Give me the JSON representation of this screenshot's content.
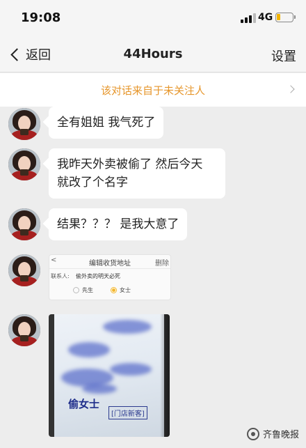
{
  "status_bar": {
    "time": "19:08",
    "network": "4G",
    "battery_level": 0.25,
    "icons": [
      "signal-icon",
      "battery-icon"
    ]
  },
  "nav": {
    "back_label": "返回",
    "title": "44Hours",
    "settings_label": "设置"
  },
  "notice": {
    "text": "该对话来自于未关注人"
  },
  "messages": [
    {
      "type": "text",
      "lines": [
        "全有姐姐 我气死了"
      ]
    },
    {
      "type": "text",
      "lines": [
        "我昨天外卖被偷了 然后今天",
        "就改了个名字"
      ]
    },
    {
      "type": "text",
      "lines": [
        "结果？？？ 是我大意了"
      ]
    },
    {
      "type": "image",
      "image": {
        "kind": "address-form-screenshot",
        "back": "<",
        "title": "编辑收货地址",
        "delete": "删除",
        "contact_label": "联系人:",
        "contact_value": "偷外卖的明天必死",
        "options": [
          "先生",
          "女士"
        ],
        "selected_option": "女士"
      }
    },
    {
      "type": "image",
      "image": {
        "kind": "photo-of-delivery-bag",
        "name_text": "偷女士",
        "stamp_text": "[门店新客]"
      }
    }
  ],
  "watermark": {
    "text": "齐鲁晚报"
  },
  "colors": {
    "background": "#ededed",
    "notice": "#e6962b",
    "bubble": "#ffffff"
  }
}
